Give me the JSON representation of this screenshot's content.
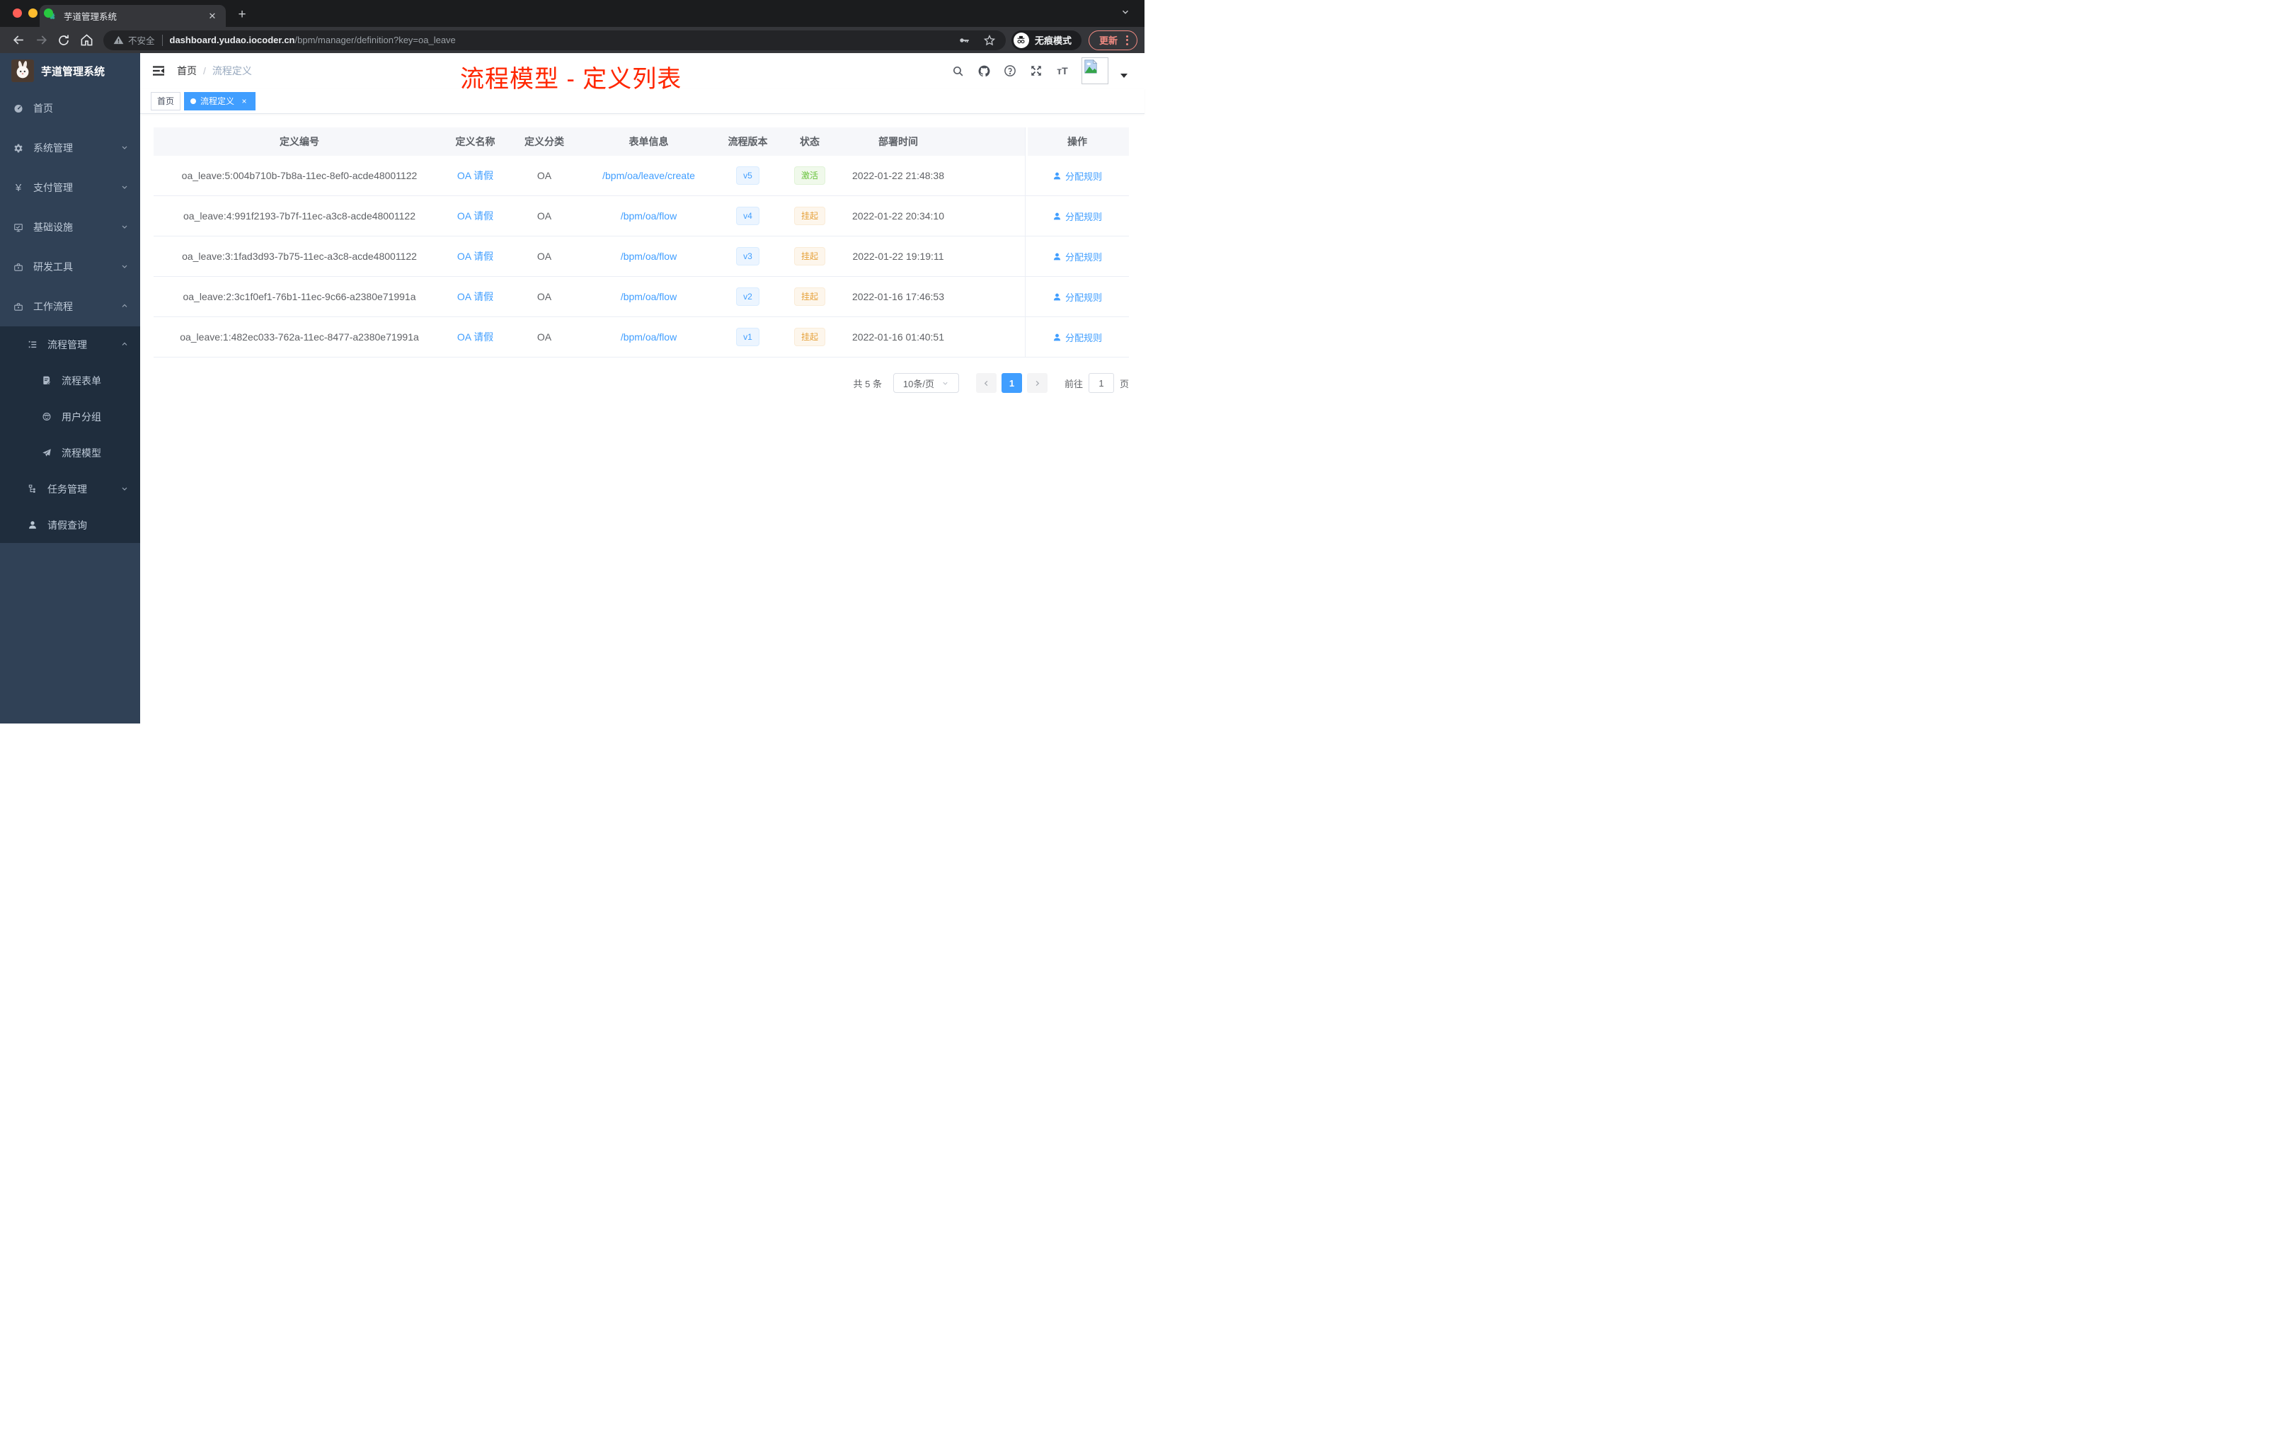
{
  "browser": {
    "tab_title": "芋道管理系统",
    "security_warning": "不安全",
    "url_domain": "dashboard.yudao.iocoder.cn",
    "url_path": "/bpm/manager/definition?key=oa_leave",
    "incognito_label": "无痕模式",
    "update_button": "更新",
    "colors": {
      "traffic_red": "#ff5f57",
      "traffic_yellow": "#febc2e",
      "traffic_green": "#28c840"
    }
  },
  "sidebar": {
    "title": "芋道管理系统",
    "items": [
      {
        "label": "首页",
        "icon": "dashboard-icon"
      },
      {
        "label": "系统管理",
        "icon": "gear-icon"
      },
      {
        "label": "支付管理",
        "icon": "yen-icon"
      },
      {
        "label": "基础设施",
        "icon": "monitor-icon"
      },
      {
        "label": "研发工具",
        "icon": "toolbox-icon"
      },
      {
        "label": "工作流程",
        "icon": "briefcase-icon"
      },
      {
        "label": "流程管理",
        "icon": "list-icon"
      },
      {
        "label": "流程表单",
        "icon": "form-icon"
      },
      {
        "label": "用户分组",
        "icon": "user-group-icon"
      },
      {
        "label": "流程模型",
        "icon": "paper-plane-icon"
      },
      {
        "label": "任务管理",
        "icon": "tree-icon"
      },
      {
        "label": "请假查询",
        "icon": "user-icon"
      }
    ]
  },
  "header": {
    "breadcrumb_home": "首页",
    "breadcrumb_separator": "/",
    "breadcrumb_current": "流程定义"
  },
  "annotation": {
    "text": "流程模型 - 定义列表",
    "color": "#ff2600"
  },
  "tags": {
    "home_label": "首页",
    "active_label": "流程定义",
    "close_glyph": "×"
  },
  "table": {
    "columns": [
      "定义编号",
      "定义名称",
      "定义分类",
      "表单信息",
      "流程版本",
      "状态",
      "部署时间",
      "操作"
    ],
    "rows": [
      {
        "id": "oa_leave:5:004b710b-7b8a-11ec-8ef0-acde48001122",
        "name": "OA 请假",
        "category": "OA",
        "form": "/bpm/oa/leave/create",
        "version": "v5",
        "status": "激活",
        "time": "2022-01-22 21:48:38",
        "action": "分配规则"
      },
      {
        "id": "oa_leave:4:991f2193-7b7f-11ec-a3c8-acde48001122",
        "name": "OA 请假",
        "category": "OA",
        "form": "/bpm/oa/flow",
        "version": "v4",
        "status": "挂起",
        "time": "2022-01-22 20:34:10",
        "action": "分配规则"
      },
      {
        "id": "oa_leave:3:1fad3d93-7b75-11ec-a3c8-acde48001122",
        "name": "OA 请假",
        "category": "OA",
        "form": "/bpm/oa/flow",
        "version": "v3",
        "status": "挂起",
        "time": "2022-01-22 19:19:11",
        "action": "分配规则"
      },
      {
        "id": "oa_leave:2:3c1f0ef1-76b1-11ec-9c66-a2380e71991a",
        "name": "OA 请假",
        "category": "OA",
        "form": "/bpm/oa/flow",
        "version": "v2",
        "status": "挂起",
        "time": "2022-01-16 17:46:53",
        "action": "分配规则"
      },
      {
        "id": "oa_leave:1:482ec033-762a-11ec-8477-a2380e71991a",
        "name": "OA 请假",
        "category": "OA",
        "form": "/bpm/oa/flow",
        "version": "v1",
        "status": "挂起",
        "time": "2022-01-16 01:40:51",
        "action": "分配规则"
      }
    ]
  },
  "pagination": {
    "total": "共 5 条",
    "page_size": "10条/页",
    "current_page": "1",
    "goto_label": "前往",
    "page_unit": "页",
    "input_value": "1"
  },
  "colors": {
    "accent": "#409eff",
    "sidebar_bg": "#304156",
    "submenu_bg": "#1f2d3d",
    "status_active": "#67c23a",
    "status_suspend": "#e6a23c",
    "annotation_red": "#ff2600"
  }
}
